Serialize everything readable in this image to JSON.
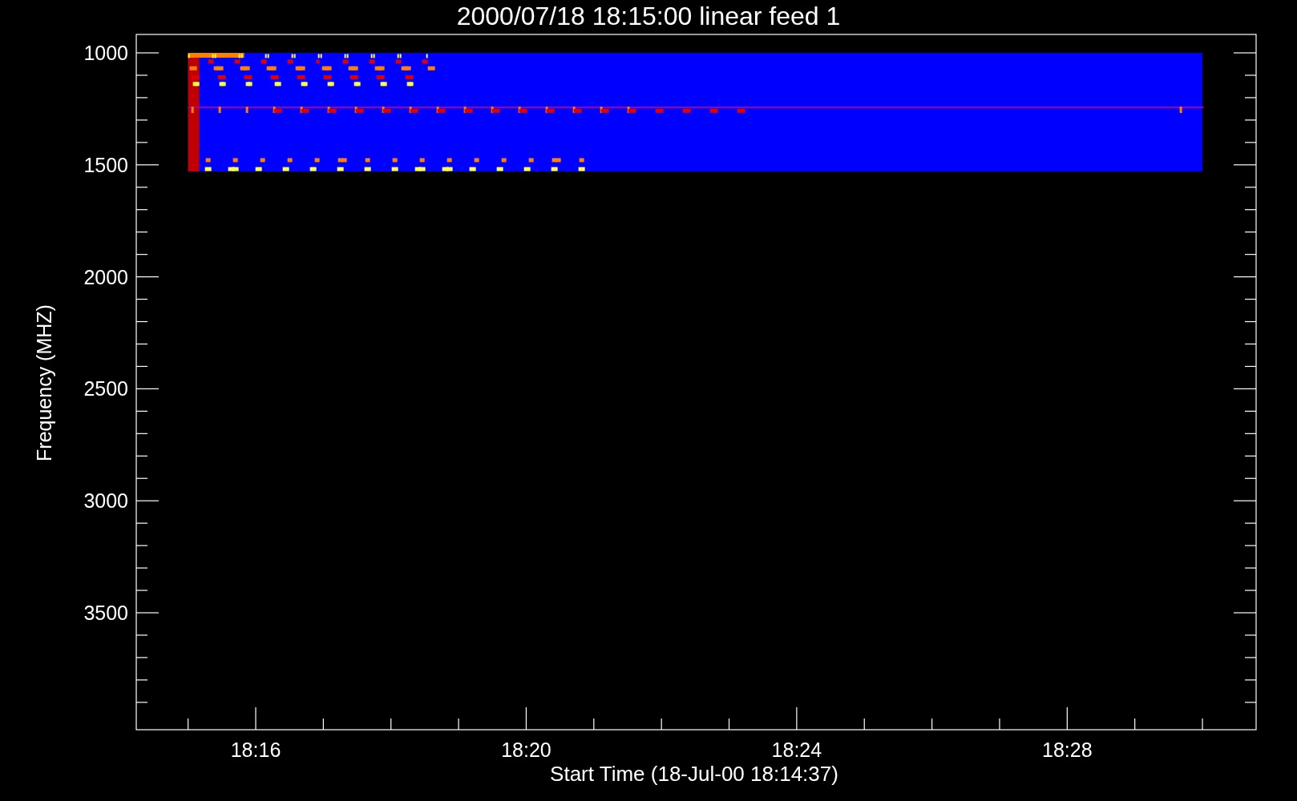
{
  "plot": {
    "title": "2000/07/18 18:15:00 linear feed 1",
    "xlabel": "Start Time (18-Jul-00 18:14:37)",
    "ylabel": "Frequency (MHZ)",
    "yticks": [
      "1000",
      "1500",
      "2000",
      "2500",
      "3000",
      "3500"
    ],
    "xticks": [
      "18:16",
      "18:20",
      "18:24",
      "18:28"
    ]
  }
}
